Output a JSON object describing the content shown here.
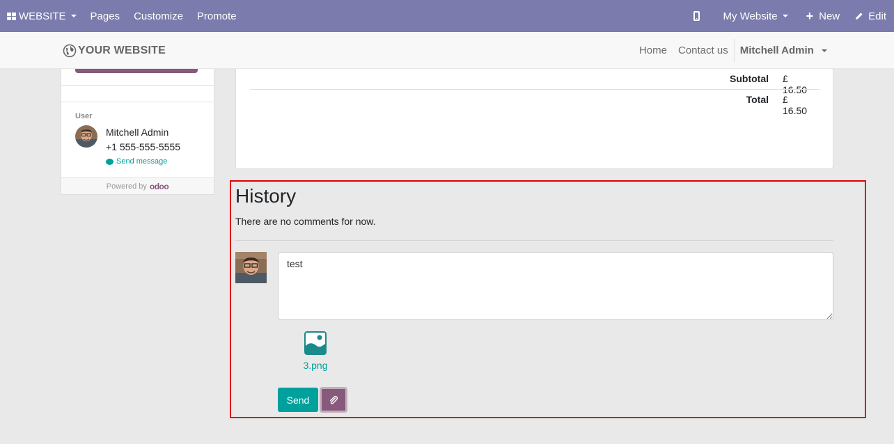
{
  "admin_bar": {
    "apps_label": "WEBSITE",
    "menu": [
      "Pages",
      "Customize",
      "Promote"
    ],
    "website_selector": "My Website",
    "new_label": "New",
    "edit_label": "Edit",
    "background": "#7c7bad"
  },
  "header": {
    "logo_text": "YOUR WEBSITE",
    "nav": {
      "home": "Home",
      "contact": "Contact us",
      "user": "Mitchell Admin"
    }
  },
  "sidebar": {
    "user_label": "User",
    "user_name": "Mitchell Admin",
    "user_phone": "+1 555-555-5555",
    "send_message": "Send message",
    "powered_by": "Powered by",
    "powered_brand": "odoo"
  },
  "totals": {
    "subtotal_label": "Subtotal",
    "subtotal_value": "£ 16.50",
    "total_label": "Total",
    "total_value": "£ 16.50"
  },
  "history": {
    "title": "History",
    "empty_text": "There are no comments for now.",
    "comment_value": "test",
    "attachment_name": "3.png",
    "send_label": "Send"
  },
  "colors": {
    "accent_teal": "#00a09d",
    "brand_purple": "#875a7b",
    "highlight_border": "#dd0000"
  }
}
